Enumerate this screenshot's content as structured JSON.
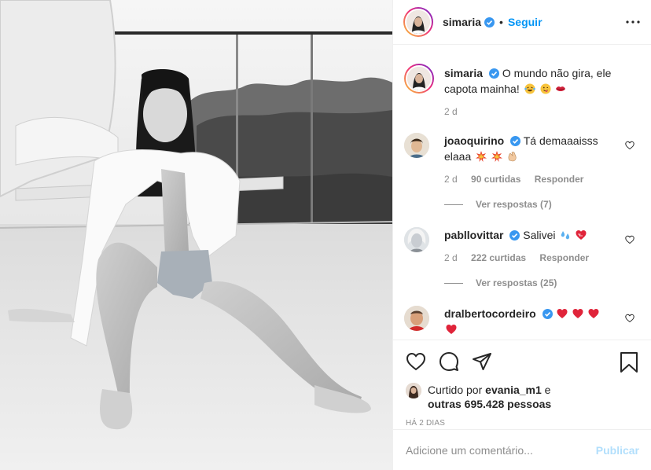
{
  "post": {
    "author": "simaria",
    "follow_label": "Seguir",
    "more_icon": "more-horizontal-icon",
    "photo_alt": "photo",
    "caption": {
      "username": "simaria",
      "text": "O mundo não gira, ele capota mainha!",
      "emojis": [
        "laughing-tears-emoji",
        "wink-tongue-emoji",
        "kiss-lips-emoji"
      ],
      "time": "2 d"
    },
    "comments": [
      {
        "username": "joaoquirino",
        "text": "Tá demaaaisss elaaa",
        "emojis": [
          "collision-emoji",
          "collision-emoji",
          "clap-emoji"
        ],
        "time": "2 d",
        "likes": "90 curtidas",
        "reply_label": "Responder",
        "view_replies": "Ver respostas (7)"
      },
      {
        "username": "pabllovittar",
        "text": "Salivei",
        "emojis": [
          "sweat-droplets-emoji",
          "heart-on-fire-emoji"
        ],
        "time": "2 d",
        "likes": "222 curtidas",
        "reply_label": "Responder",
        "view_replies": "Ver respostas (25)"
      },
      {
        "username": "dralbertocordeiro",
        "text": "",
        "emojis": [
          "red-heart-emoji",
          "red-heart-emoji",
          "red-heart-emoji",
          "red-heart-emoji"
        ]
      }
    ],
    "likes_summary": {
      "prefix": "Curtido por",
      "user": "evania_m1",
      "connector": "e",
      "others": "outras 695.428 pessoas"
    },
    "time_ago": "HÁ 2 DIAS",
    "add_comment": {
      "placeholder": "Adicione um comentário...",
      "publish_label": "Publicar"
    },
    "colors": {
      "link": "#0095f6",
      "muted": "#8e8e8e",
      "publish_disabled": "#b2dffc",
      "verified": "#3897f0"
    }
  }
}
